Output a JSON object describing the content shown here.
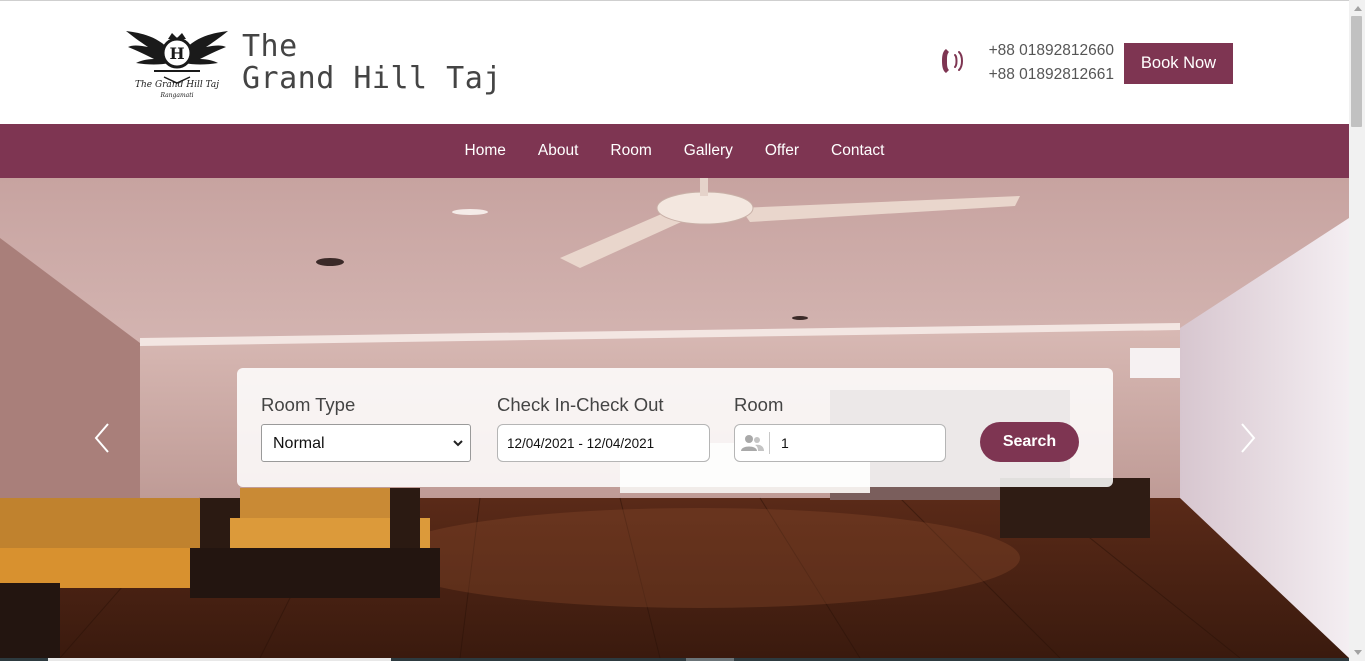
{
  "header": {
    "brand_line1": "The",
    "brand_line2": "Grand Hill Taj",
    "logo_text": "The Grand Hill Taj",
    "logo_subtext": "Rangamati",
    "logo_letter": "H",
    "phones": [
      "+88 01892812660",
      "+88 01892812661"
    ],
    "book_now_label": "Book Now"
  },
  "nav": {
    "items": [
      "Home",
      "About",
      "Room",
      "Gallery",
      "Offer",
      "Contact"
    ]
  },
  "search": {
    "room_type_label": "Room Type",
    "room_type_value": "Normal",
    "dates_label": "Check In-Check Out",
    "dates_value": "12/04/2021 - 12/04/2021",
    "room_label": "Room",
    "room_value": "1",
    "search_label": "Search"
  },
  "colors": {
    "accent": "#7e3552",
    "nav_text": "#ffffff"
  },
  "icons": [
    "phone-ringing-icon",
    "people-icon",
    "chevron-left-icon",
    "chevron-right-icon",
    "chevron-down-icon"
  ]
}
